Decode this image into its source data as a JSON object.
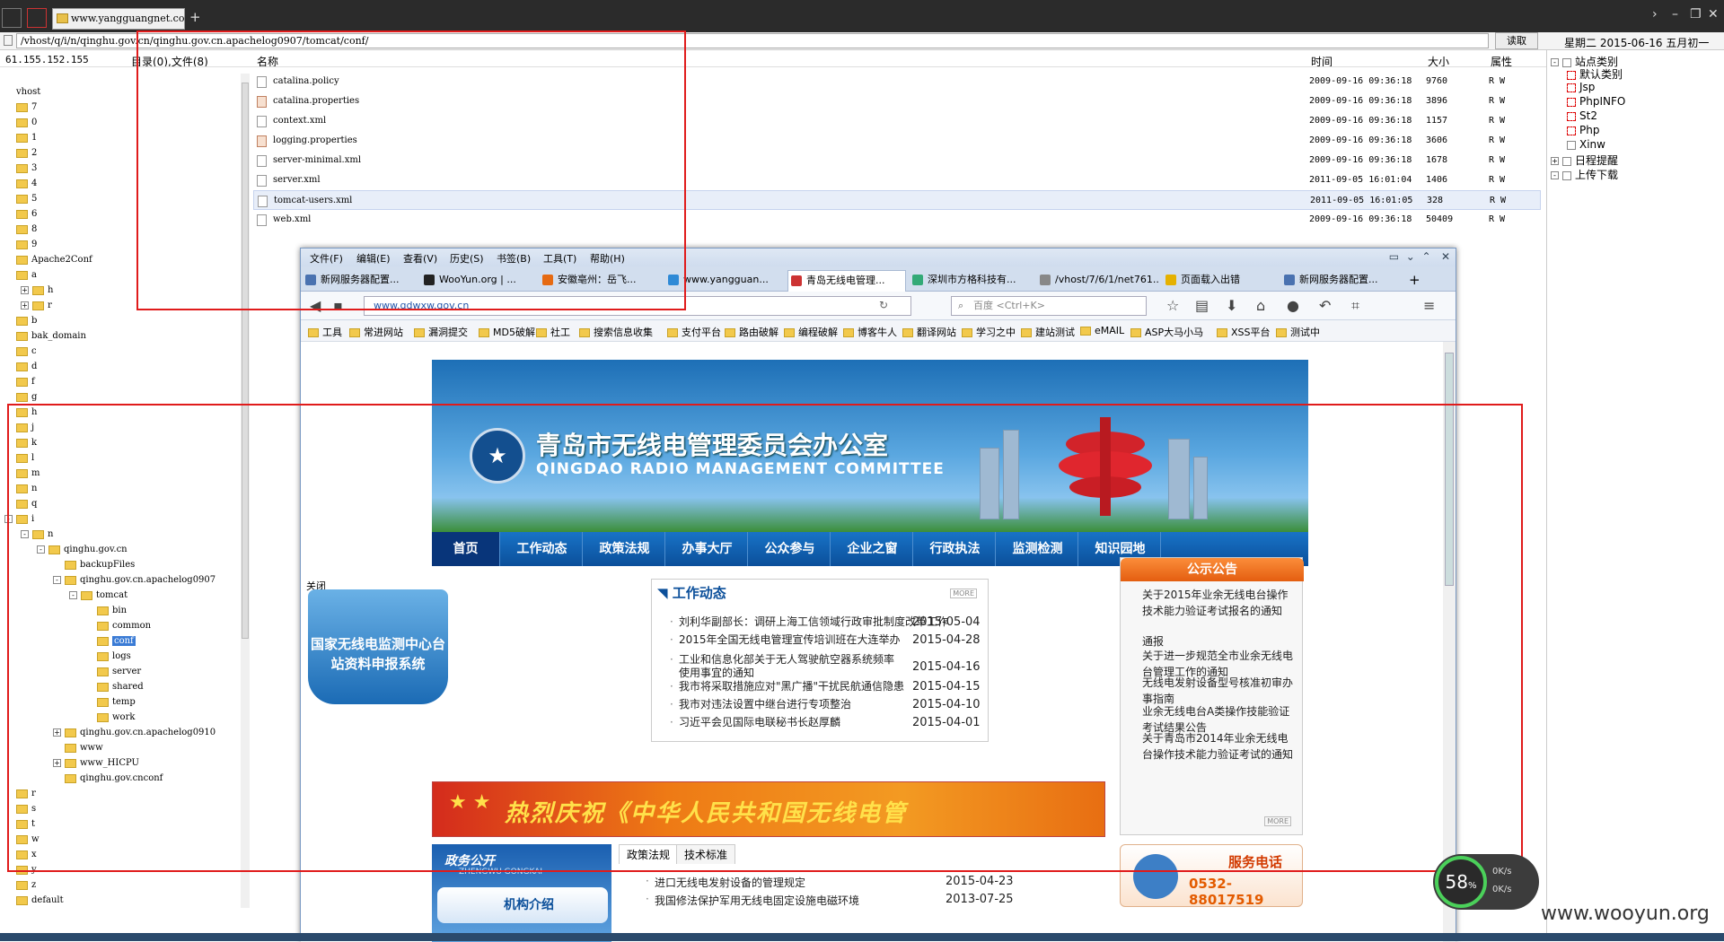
{
  "tab": {
    "title": "www.yangguangnet.com"
  },
  "path": {
    "value": "/vhost/q/i/n/qinghu.gov.cn/qinghu.gov.cn.apachelog0907/tomcat/conf/",
    "read_button": "读取"
  },
  "datetime": "星期二 2015-06-16 五月初一",
  "ip": "61.155.152.155",
  "columns": {
    "dirinfo": "目录(0),文件(8)",
    "name": "名称",
    "time": "时间",
    "size": "大小",
    "attr": "属性"
  },
  "files": [
    {
      "name": "catalina.policy",
      "time": "2009-09-16 09:36:18",
      "size": "9760",
      "attr": "R W"
    },
    {
      "name": "catalina.properties",
      "time": "2009-09-16 09:36:18",
      "size": "3896",
      "attr": "R W"
    },
    {
      "name": "context.xml",
      "time": "2009-09-16 09:36:18",
      "size": "1157",
      "attr": "R W"
    },
    {
      "name": "logging.properties",
      "time": "2009-09-16 09:36:18",
      "size": "3606",
      "attr": "R W"
    },
    {
      "name": "server-minimal.xml",
      "time": "2009-09-16 09:36:18",
      "size": "1678",
      "attr": "R W"
    },
    {
      "name": "server.xml",
      "time": "2011-09-05 16:01:04",
      "size": "1406",
      "attr": "R W"
    },
    {
      "name": "tomcat-users.xml",
      "time": "2011-09-05 16:01:05",
      "size": "328",
      "attr": "R W"
    },
    {
      "name": "web.xml",
      "time": "2009-09-16 09:36:18",
      "size": "50409",
      "attr": "R W"
    }
  ],
  "tree": [
    {
      "label": "vhost"
    },
    {
      "label": "7"
    },
    {
      "label": "0"
    },
    {
      "label": "1"
    },
    {
      "label": "2"
    },
    {
      "label": "3"
    },
    {
      "label": "4"
    },
    {
      "label": "5"
    },
    {
      "label": "6"
    },
    {
      "label": "8"
    },
    {
      "label": "9"
    },
    {
      "label": "Apache2Conf"
    },
    {
      "label": "a"
    },
    {
      "label": "h"
    },
    {
      "label": "r"
    },
    {
      "label": "b"
    },
    {
      "label": "bak_domain"
    },
    {
      "label": "c"
    },
    {
      "label": "d"
    },
    {
      "label": "f"
    },
    {
      "label": "g"
    },
    {
      "label": "h"
    },
    {
      "label": "j"
    },
    {
      "label": "k"
    },
    {
      "label": "l"
    },
    {
      "label": "m"
    },
    {
      "label": "n"
    },
    {
      "label": "q"
    },
    {
      "label": "i"
    },
    {
      "label": "n"
    },
    {
      "label": "qinghu.gov.cn"
    },
    {
      "label": "backupFiles"
    },
    {
      "label": "qinghu.gov.cn.apachelog0907"
    },
    {
      "label": "tomcat"
    },
    {
      "label": "bin"
    },
    {
      "label": "common"
    },
    {
      "label": "conf"
    },
    {
      "label": "logs"
    },
    {
      "label": "server"
    },
    {
      "label": "shared"
    },
    {
      "label": "temp"
    },
    {
      "label": "work"
    },
    {
      "label": "qinghu.gov.cn.apachelog0910"
    },
    {
      "label": "www"
    },
    {
      "label": "www_HICPU"
    },
    {
      "label": "qinghu.gov.cnconf"
    },
    {
      "label": "r"
    },
    {
      "label": "s"
    },
    {
      "label": "t"
    },
    {
      "label": "w"
    },
    {
      "label": "x"
    },
    {
      "label": "y"
    },
    {
      "label": "z"
    },
    {
      "label": "default"
    }
  ],
  "right_panel": [
    "站点类别",
    "默认类别",
    "Jsp",
    "PhpINFO",
    "St2",
    "Php",
    "Xinw",
    "日程提醒",
    "上传下载"
  ],
  "browser": {
    "menu": [
      "文件(F)",
      "编辑(E)",
      "查看(V)",
      "历史(S)",
      "书签(B)",
      "工具(T)",
      "帮助(H)"
    ],
    "tabs": [
      "新网服务器配置...",
      "WooYun.org | ...",
      "安徽亳州：岳飞...",
      "www.yangguan...",
      "青岛无线电管理...",
      "深圳市方格科技有...",
      "/vhost/7/6/1/net761...",
      "页面载入出错",
      "新网服务器配置..."
    ],
    "url": "www.qdwxw.gov.cn",
    "search_placeholder": "百度 <Ctrl+K>",
    "bookmarks": [
      "工具",
      "常进网站",
      "漏洞提交",
      "MD5破解",
      "社工",
      "搜索信息收集",
      "支付平台",
      "路由破解",
      "编程破解",
      "博客牛人",
      "翻译网站",
      "学习之中",
      "建站测试",
      "eMAIL",
      "ASP大马小马",
      "XSS平台",
      "测试中"
    ]
  },
  "site": {
    "title_cn": "青岛市无线电管理委员会办公室",
    "title_en": "QINGDAO RADIO MANAGEMENT COMMITTEE",
    "nav": [
      "首页",
      "工作动态",
      "政策法规",
      "办事大厅",
      "公众参与",
      "企业之窗",
      "行政执法",
      "监测检测",
      "知识园地"
    ],
    "close_label": "关闭",
    "float_text": "国家无线电监测中心台站资料申报系统",
    "work_title": "工作动态",
    "more": "MORE",
    "work_news": [
      {
        "title": "刘利华副部长：调研上海工信领域行政审批制度改革工作",
        "date": "2015-05-04"
      },
      {
        "title": "2015年全国无线电管理宣传培训班在大连举办",
        "date": "2015-04-28"
      },
      {
        "title": "工业和信息化部关于无人驾驶航空器系统频率使用事宜的通知",
        "date": "2015-04-16"
      },
      {
        "title": "我市将采取措施应对\"黑广播\"干扰民航通信隐患",
        "date": "2015-04-15"
      },
      {
        "title": "我市对违法设置中继台进行专项整治",
        "date": "2015-04-10"
      },
      {
        "title": "习近平会见国际电联秘书长赵厚麟",
        "date": "2015-04-01"
      }
    ],
    "notice_title": "公示公告",
    "notices": [
      "关于2015年业余无线电台操作技术能力验证考试报名的通知",
      "通报",
      "关于进一步规范全市业余无线电台管理工作的通知",
      "无线电发射设备型号核准初审办事指南",
      "业余无线电台A类操作技能验证考试结果公告",
      "关于青岛市2014年业余无线电台操作技术能力验证考试的通知"
    ],
    "flag_text": "热烈庆祝《中华人民共和国无线电管",
    "zw_title": "政务公开",
    "zw_sub": "ZHENGWU GONGKAI",
    "jg": "机构介绍",
    "tabs2": [
      "政策法规",
      "技术标准"
    ],
    "policy_news": [
      {
        "title": "进口无线电发射设备的管理规定",
        "date": "2015-04-23"
      },
      {
        "title": "我国修法保护军用无线电固定设施电磁环境",
        "date": "2013-07-25"
      }
    ],
    "tel_label": "服务电话",
    "tel_number": "0532-88017519"
  },
  "gauge": {
    "percent": "58",
    "unit": "%",
    "up": "0K/s",
    "down": "0K/s"
  },
  "watermark": "www.wooyun.org"
}
